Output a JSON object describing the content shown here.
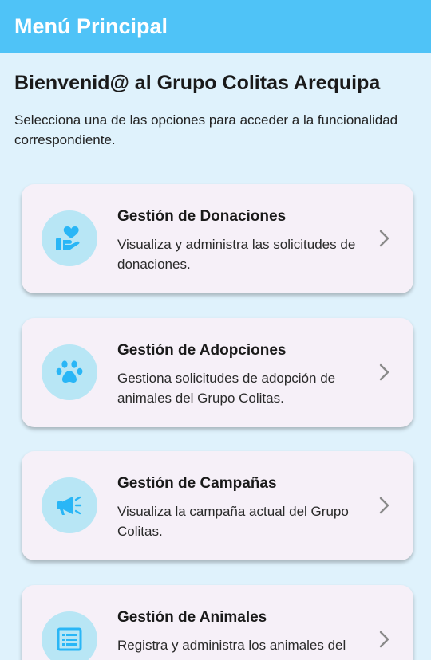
{
  "appbar": {
    "title": "Menú Principal"
  },
  "header": {
    "welcome": "Bienvenid@ al Grupo Colitas Arequipa",
    "subtitle": "Selecciona una de las opciones para acceder a la funcionalidad correspondiente."
  },
  "cards": [
    {
      "title": "Gestión de Donaciones",
      "description": "Visualiza y administra las solicitudes de donaciones.",
      "icon": "donation-hand-heart-icon"
    },
    {
      "title": "Gestión de Adopciones",
      "description": "Gestiona solicitudes de adopción de animales del Grupo Colitas.",
      "icon": "paw-icon"
    },
    {
      "title": "Gestión de Campañas",
      "description": "Visualiza la campaña actual del Grupo Colitas.",
      "icon": "megaphone-icon"
    },
    {
      "title": "Gestión de Animales",
      "description": "Registra y administra los animales del",
      "icon": "list-icon"
    }
  ],
  "colors": {
    "appbar": "#4fc3f7",
    "background": "#dff2fc",
    "card": "#f6f0f8",
    "icon_circle": "#b8e6f5",
    "icon": "#29b6f6",
    "chevron": "#8a8a8a"
  }
}
